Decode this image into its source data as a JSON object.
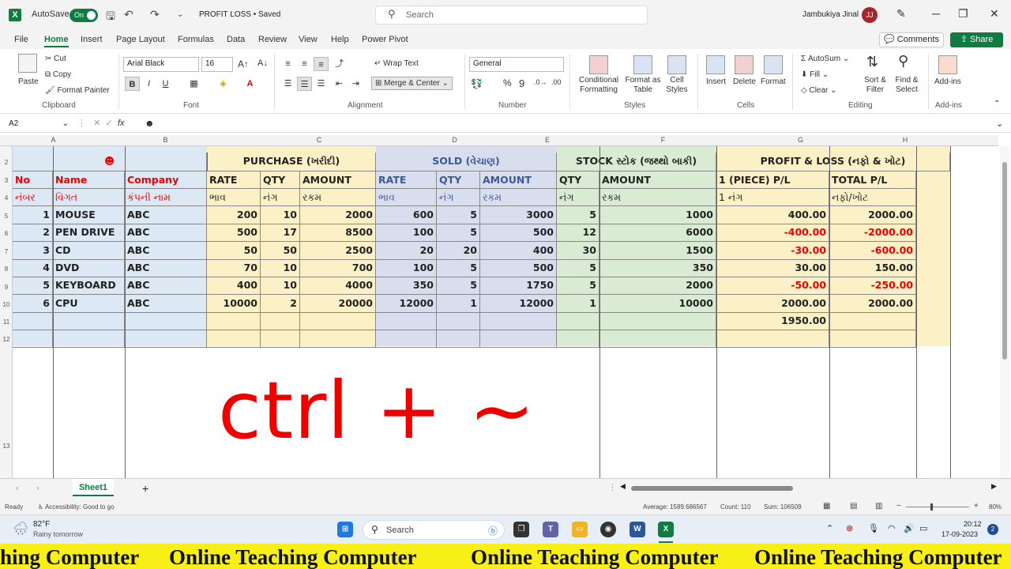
{
  "titlebar": {
    "app_icon": "excel-icon",
    "autosave_label": "AutoSave",
    "autosave_state": "On",
    "doc_title": "PROFIT LOSS • Saved",
    "search_placeholder": "Search",
    "user_name": "Jambukiya Jinal",
    "user_initials": "JJ"
  },
  "menu": {
    "tabs": [
      "File",
      "Home",
      "Insert",
      "Page Layout",
      "Formulas",
      "Data",
      "Review",
      "View",
      "Help",
      "Power Pivot"
    ],
    "active": "Home",
    "comments": "Comments",
    "share": "Share"
  },
  "ribbon": {
    "paste": "Paste",
    "cut": "Cut",
    "copy": "Copy",
    "format_painter": "Format Painter",
    "clipboard": "Clipboard",
    "font_name": "Arial Black",
    "font_size": "16",
    "font_group": "Font",
    "wrap_text": "Wrap Text",
    "merge_center": "Merge & Center",
    "alignment": "Alignment",
    "number_format": "General",
    "number": "Number",
    "conditional_formatting": "Conditional Formatting",
    "format_as_table": "Format as Table",
    "cell_styles": "Cell Styles",
    "styles": "Styles",
    "insert": "Insert",
    "delete": "Delete",
    "format": "Format",
    "cells": "Cells",
    "autosum": "AutoSum",
    "fill": "Fill",
    "clear": "Clear",
    "sort_filter": "Sort & Filter",
    "find_select": "Find & Select",
    "editing": "Editing",
    "add_ins": "Add-ins",
    "add_ins_group": "Add-ins"
  },
  "formula_bar": {
    "name_box": "A2",
    "content": "☻"
  },
  "columns": [
    "A",
    "B",
    "C",
    "D",
    "E",
    "F",
    "G",
    "H"
  ],
  "rows": [
    "2",
    "3",
    "4",
    "5",
    "6",
    "7",
    "8",
    "9",
    "10",
    "11",
    "12",
    "13"
  ],
  "sheet": {
    "smiley": "☻",
    "purchase_title": "PURCHASE (ખરીદી)",
    "sold_title": "SOLD (વેચાણ)",
    "stock_title": "STOCK સ્ટોક (જથ્થો બાકી)",
    "pl_title": "PROFIT & LOSS (નફો & ખોટ)",
    "hdr_en": {
      "no": "No",
      "name": "Name",
      "company": "Company",
      "p_rate": "RATE",
      "p_qty": "QTY",
      "p_amount": "AMOUNT",
      "s_rate": "RATE",
      "s_qty": "QTY",
      "s_amount": "AMOUNT",
      "k_qty": "QTY",
      "k_amount": "AMOUNT",
      "pl_piece": "1 (PIECE)  P/L",
      "pl_total": "TOTAL P/L"
    },
    "hdr_gu": {
      "no": "નંબર",
      "name": "વિગત",
      "company": "કંપની નામ",
      "p_rate": "ભાવ",
      "p_qty": "નંગ",
      "p_amount": "રકમ",
      "s_rate": "ભાવ",
      "s_qty": "નંગ",
      "s_amount": "રકમ",
      "k_qty": "નંગ",
      "k_amount": "રકમ",
      "pl_piece": "1 નંગ",
      "pl_total": "નફો/ખોટ"
    },
    "data": [
      [
        "1",
        "MOUSE",
        "ABC",
        "200",
        "10",
        "2000",
        "600",
        "5",
        "3000",
        "5",
        "1000",
        "400.00",
        "2000.00"
      ],
      [
        "2",
        "PEN DRIVE",
        "ABC",
        "500",
        "17",
        "8500",
        "100",
        "5",
        "500",
        "12",
        "6000",
        "-400.00",
        "-2000.00"
      ],
      [
        "3",
        "CD",
        "ABC",
        "50",
        "50",
        "2500",
        "20",
        "20",
        "400",
        "30",
        "1500",
        "-30.00",
        "-600.00"
      ],
      [
        "4",
        "DVD",
        "ABC",
        "70",
        "10",
        "700",
        "100",
        "5",
        "500",
        "5",
        "350",
        "30.00",
        "150.00"
      ],
      [
        "5",
        "KEYBOARD",
        "ABC",
        "400",
        "10",
        "4000",
        "350",
        "5",
        "1750",
        "5",
        "2000",
        "-50.00",
        "-250.00"
      ],
      [
        "6",
        "CPU",
        "ABC",
        "10000",
        "2",
        "20000",
        "12000",
        "1",
        "12000",
        "1",
        "10000",
        "2000.00",
        "2000.00"
      ]
    ],
    "total_piece_pl": "1950.00",
    "overlay_text": "ctrl + ~"
  },
  "sheet_tabs": {
    "active": "Sheet1",
    "add": "+"
  },
  "status": {
    "ready": "Ready",
    "accessibility": "Accessibility: Good to go",
    "average": "Average: 1589.686567",
    "count": "Count: 110",
    "sum": "Sum: 106509",
    "zoom": "80%"
  },
  "taskbar": {
    "temp": "82°F",
    "weather": "Rainy tomorrow",
    "search": "Search",
    "time": "20:12",
    "date": "17-09-2023",
    "badge": "2"
  },
  "banner": {
    "text": "Online Teaching Computer",
    "text_cut": "hing Computer"
  },
  "colors": {
    "excel_green": "#107c41",
    "purchase_bg": "#fbf0c6",
    "sold_bg": "#d8deee",
    "stock_bg": "#d9ecd3",
    "name_bg": "#dce9f5",
    "negative": "#e00000",
    "banner_bg": "#f7ef15"
  }
}
